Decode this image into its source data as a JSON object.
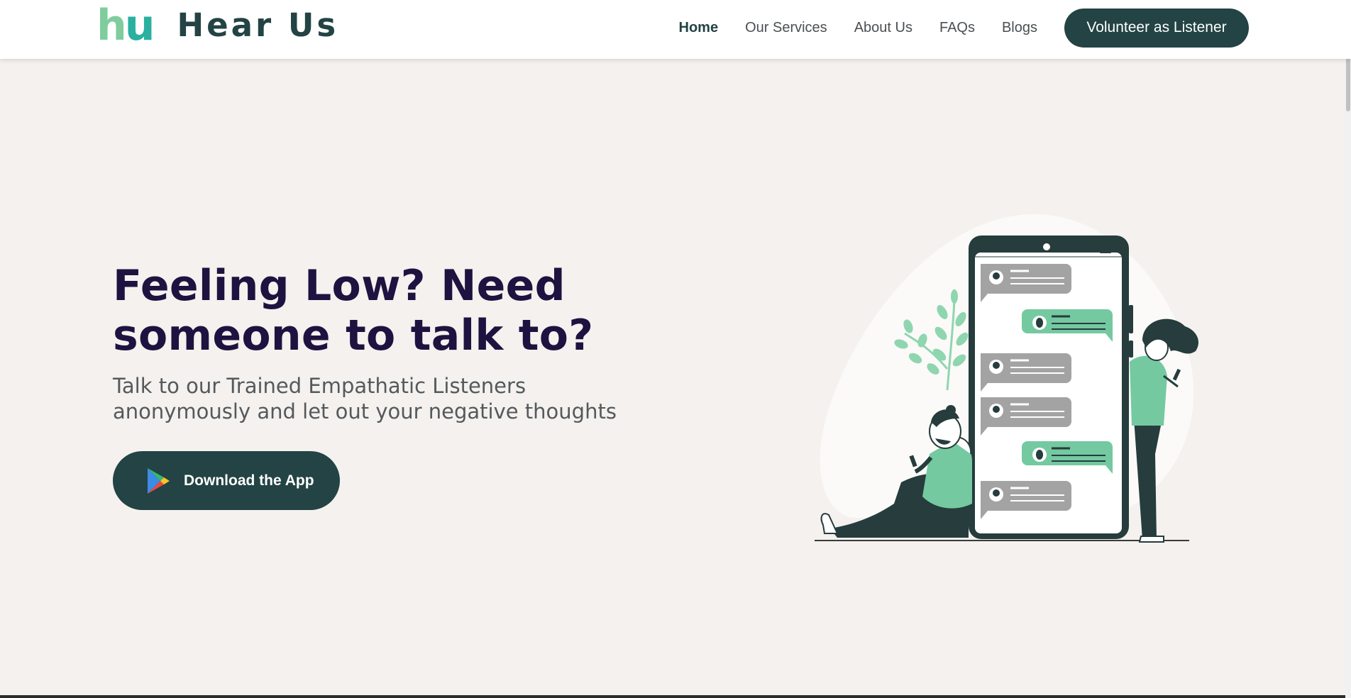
{
  "brand": {
    "logo_h": "h",
    "logo_u": "u",
    "name": "Hear Us"
  },
  "nav": {
    "items": [
      {
        "label": "Home",
        "active": true
      },
      {
        "label": "Our Services"
      },
      {
        "label": "About Us"
      },
      {
        "label": "FAQs"
      },
      {
        "label": "Blogs"
      }
    ],
    "cta_label": "Volunteer as Listener"
  },
  "hero": {
    "title_line1": "Feeling Low? Need",
    "title_line2": "someone to talk to?",
    "subtitle_line1": "Talk to our Trained Empathatic Listeners",
    "subtitle_line2": "anonymously and let out your negative thoughts",
    "download_label": "Download the App",
    "download_icon": "google-play-icon"
  },
  "illustration": {
    "name": "people-chatting-on-phone-illustration"
  },
  "colors": {
    "primary": "#234344",
    "title": "#1e1240",
    "accent_green": "#7fcc9c",
    "accent_teal": "#2ab0a0",
    "page_bg": "#f4f1ee",
    "chat_green": "#74c9a1",
    "chat_gray": "#a3a3a3"
  }
}
